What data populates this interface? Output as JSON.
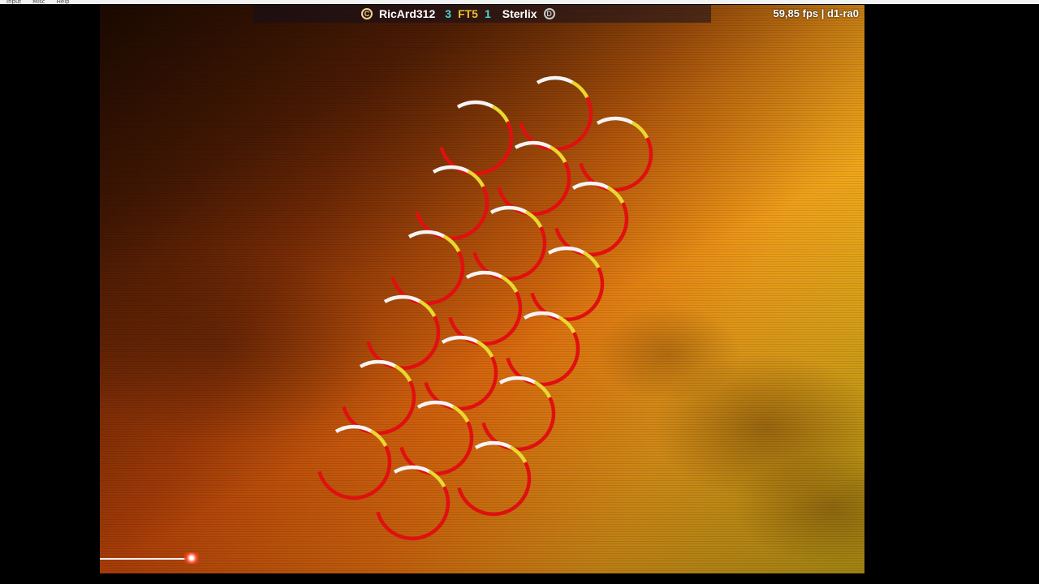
{
  "menu": {
    "items": [
      "Input",
      "Misc",
      "Help"
    ]
  },
  "scoreboard": {
    "player1_name": "RicArd312",
    "player1_score": "3",
    "match_format": "FT5",
    "player2_score": "1",
    "player2_name": "Sterlix",
    "player1_icon": "c-circle-icon",
    "player1_icon_letter": "C",
    "player2_icon": "d-circle-icon",
    "player2_icon_letter": "D"
  },
  "status": {
    "fps_text": "59,85 fps | d1-ra0"
  },
  "progress": {
    "fraction": 0.12
  },
  "colors": {
    "note_main": "#e01010",
    "note_mid": "#e8d830",
    "note_tip": "#f4f4f4",
    "score_accent": "#47d8c8",
    "format_accent": "#f0c030"
  }
}
